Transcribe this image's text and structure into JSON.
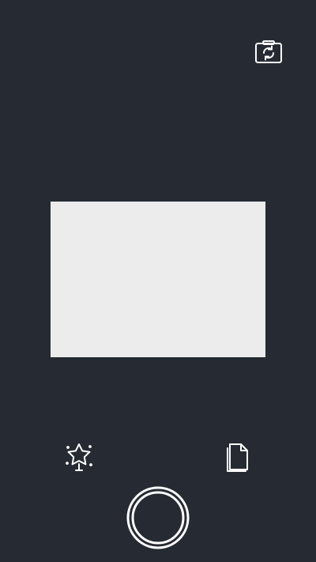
{
  "screen": {
    "background": "#262b33"
  },
  "icons": {
    "flip_camera": "camera-switch-icon",
    "effects": "star-sparkle-icon",
    "document": "document-icon",
    "shutter": "shutter-icon"
  },
  "viewfinder": {
    "fill": "#ececec"
  },
  "colors": {
    "icon": "#ffffff",
    "accent": "#ffffff"
  }
}
